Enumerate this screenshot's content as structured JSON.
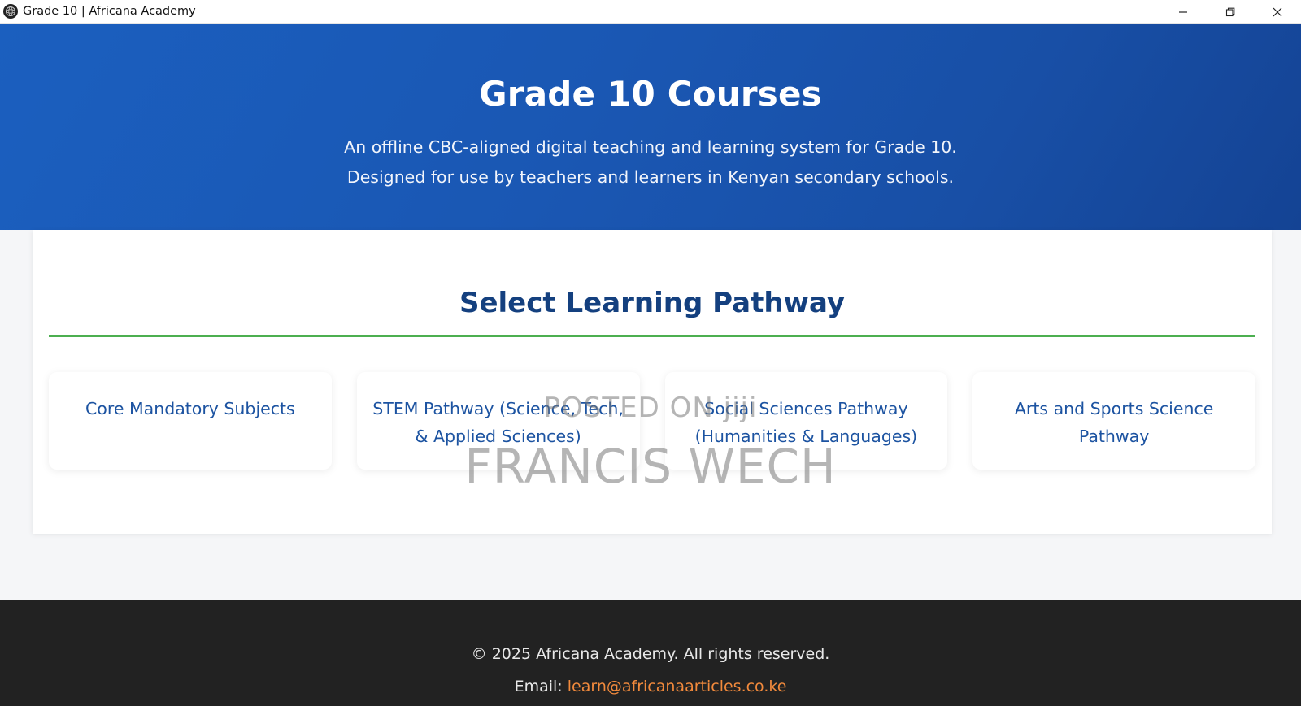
{
  "window": {
    "title": "Grade 10 | Africana Academy",
    "icon": "app-logo-icon",
    "controls": [
      "minimize-icon",
      "restore-icon",
      "close-icon"
    ]
  },
  "hero": {
    "title": "Grade 10 Courses",
    "subtitle_line1": "An offline CBC-aligned digital teaching and learning system for Grade 10.",
    "subtitle_line2": "Designed for use by teachers and learners in Kenyan secondary schools.",
    "color": "#1a57b3"
  },
  "section": {
    "title": "Select Learning Pathway",
    "accent_color": "#4caf50"
  },
  "pathways": [
    {
      "label": "Core Mandatory Subjects"
    },
    {
      "label": "STEM Pathway (Science, Tech, & Applied Sciences)"
    },
    {
      "label": "Social Sciences Pathway (Humanities & Languages)"
    },
    {
      "label": "Arts and Sports Science Pathway"
    }
  ],
  "watermark": {
    "line1": "POSTED ON jiji",
    "line2": "FRANCIS WECH"
  },
  "footer": {
    "copyright": "© 2025 Africana Academy. All rights reserved.",
    "email_label": "Email: ",
    "email": "learn@africanaarticles.co.ke",
    "link_color": "#f28a3c"
  }
}
